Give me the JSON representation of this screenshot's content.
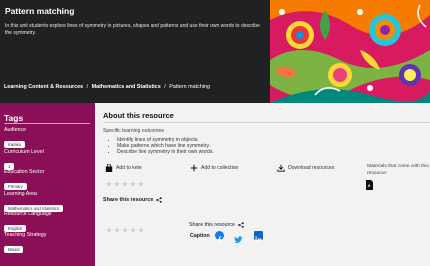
{
  "hero": {
    "title": "Pattern matching",
    "description": "In this unit students explore lines of symmetry in pictures, shapes and patterns and use their own words to describe the symmetry."
  },
  "breadcrumb": {
    "items": [
      "Learning Content & Resources",
      "Mathematics and Statistics"
    ],
    "separator": "/",
    "current": "Pattern matching"
  },
  "sidebar": {
    "title": "Tags",
    "groups": [
      {
        "label": "Audience",
        "value": "Kaiako"
      },
      {
        "label": "Curriculum Level",
        "value": "1"
      },
      {
        "label": "Education Sector",
        "value": "Primary"
      },
      {
        "label": "Learning Area",
        "value": "Mathematics and Statistics"
      },
      {
        "label": "Resource Language",
        "value": "English"
      },
      {
        "label": "Teaching Strategy",
        "value": "Mixed"
      }
    ]
  },
  "main": {
    "title": "About this resource",
    "outcomes_label": "Specific learning outcomes",
    "outcomes": [
      "Identify lines of symmetry in objects.",
      "Make patterns which have line symmetry.",
      "Describe line symmetry in their own words."
    ],
    "actions": {
      "kete": "Add to kete",
      "collection": "Add to collection",
      "download": "Download resources"
    },
    "materials_text": "Materials that come with this resource:",
    "share_label": "Share this resource",
    "share_resource_label": "Share this resource",
    "caption_label": "Caption"
  },
  "colors": {
    "sidebar": "#8b0f56",
    "hero": "#1f2123",
    "facebook": "#1877f2",
    "twitter": "#1d9bf0",
    "linkedin": "#0a66c2"
  },
  "icons": [
    "bag-icon",
    "plus-icon",
    "download-icon",
    "pdf-icon",
    "star-icon",
    "share-icon",
    "facebook-icon",
    "twitter-icon",
    "linkedin-icon"
  ]
}
